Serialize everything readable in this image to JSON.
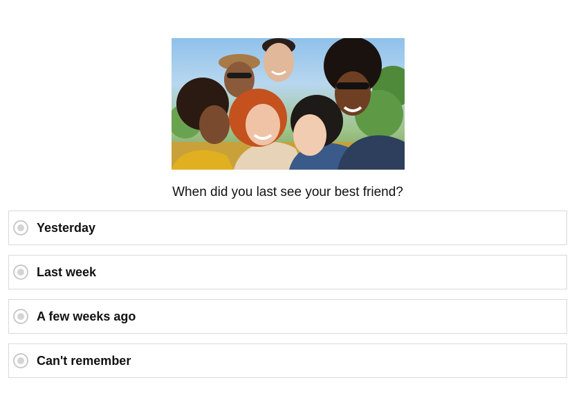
{
  "hero": {
    "image_description": "photo-group-of-friends",
    "sky_color": "#8fc1ea"
  },
  "question": {
    "text": "When did you last see your best friend?"
  },
  "options": [
    {
      "label": "Yesterday",
      "selected": false
    },
    {
      "label": "Last week",
      "selected": false
    },
    {
      "label": "A few weeks ago",
      "selected": false
    },
    {
      "label": "Can't remember",
      "selected": false
    }
  ],
  "colors": {
    "border": "#d9d9d9",
    "radio": "#c9c9c9",
    "text": "#111111"
  }
}
